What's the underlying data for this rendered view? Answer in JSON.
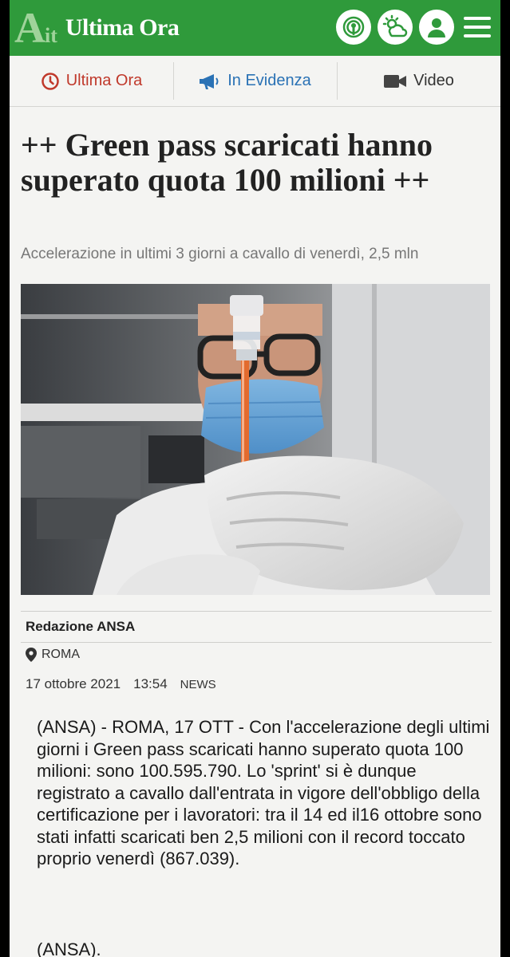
{
  "header": {
    "logo_letter": "A",
    "logo_suffix": "it",
    "title": "Ultima Ora",
    "icons": [
      "podcast-icon",
      "weather-icon",
      "user-icon",
      "menu-icon"
    ],
    "brand_color": "#2f9a3b"
  },
  "nav": {
    "items": [
      {
        "label": "Ultima Ora",
        "icon": "clock-icon",
        "color": "#c0392b"
      },
      {
        "label": "In Evidenza",
        "icon": "megaphone-icon",
        "color": "#2a72b5"
      },
      {
        "label": "Video",
        "icon": "video-camera-icon",
        "color": "#333333"
      }
    ]
  },
  "article": {
    "headline": "++ Green pass scaricati hanno superato quota 100 milioni ++",
    "subheadline": "Accelerazione in ultimi 3 giorni a cavallo di venerdì, 2,5 mln",
    "image_alt": "Operatore sanitario con mascherina e guanti prepara una siringa dal flacone di vaccino",
    "author": "Redazione ANSA",
    "location": "ROMA",
    "date": "17 ottobre 2021",
    "time": "13:54",
    "category": "NEWS",
    "body": "(ANSA) - ROMA, 17 OTT - Con l'accelerazione degli ultimi giorni i Green pass scaricati hanno superato quota 100 milioni: sono 100.595.790. Lo 'sprint' si è dunque registrato a cavallo dall'entrata in vigore dell'obbligo della certificazione per i lavoratori: tra il 14 ed il16 ottobre sono stati infatti scaricati ben 2,5 milioni con il record toccato proprio venerdì (867.039).",
    "signature": "(ANSA)."
  }
}
